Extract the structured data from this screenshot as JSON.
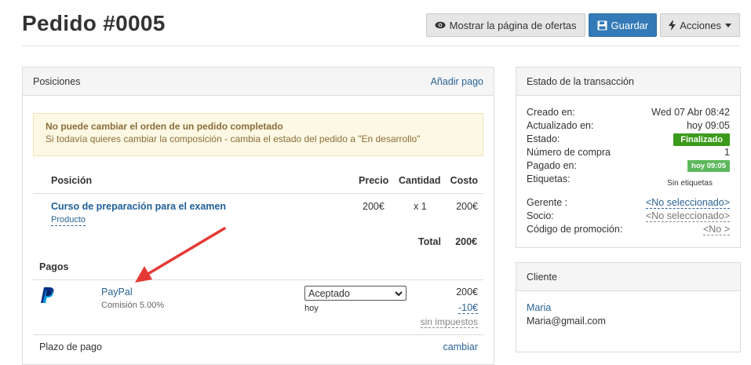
{
  "page": {
    "title": "Pedido #0005"
  },
  "header": {
    "show_offer_label": "Mostrar la página de ofertas",
    "save_label": "Guardar",
    "actions_label": "Acciones"
  },
  "positions_panel": {
    "title": "Posiciones",
    "add_payment_link": "Añadir pago",
    "warning_title": "No puede cambiar el orden de un pedido completado",
    "warning_text": "Si todavía quieres cambiar la composición - cambia el estado del pedido a \"En desarrollo\"",
    "table": {
      "headers": {
        "position": "Posición",
        "price": "Precio",
        "quantity": "Cantidad",
        "cost": "Costo"
      },
      "rows": [
        {
          "name": "Curso de preparación para el examen",
          "type": "Producto",
          "price": "200€",
          "quantity": "x 1",
          "cost": "200€"
        }
      ],
      "total_label": "Total",
      "total_value": "200€"
    },
    "payments": {
      "title": "Pagos",
      "items": [
        {
          "method": "PayPal",
          "commission": "Comisión 5.00%",
          "status": "Aceptado",
          "date": "hoy",
          "amount": "200€",
          "fee": "-10€",
          "tax": "sin impuestos"
        }
      ]
    },
    "term": {
      "label": "Plazo de pago",
      "change_link": "cambiar"
    }
  },
  "transaction_panel": {
    "title": "Estado de la transacción",
    "created_label": "Creado en:",
    "created_value": "Wed 07 Abr 08:42",
    "updated_label": "Actualizado en:",
    "updated_value": "hoy 09:05",
    "status_label": "Estado:",
    "status_value": "Finalizado",
    "purchase_number_label": "Número de compra",
    "purchase_number_value": "1",
    "paid_label": "Pagado en:",
    "paid_value": "hoy 09:05",
    "tags_label": "Etiquetas:",
    "tags_value": "Sin etiquetas",
    "manager_label": "Gerente :",
    "manager_value": "<No seleccionado>",
    "partner_label": "Socio:",
    "partner_value": "<No seleccionado>",
    "promo_label": "Código de promoción:",
    "promo_value": "<No >"
  },
  "client_panel": {
    "title": "Cliente",
    "name": "Maria",
    "email": "Maria@gmail.com"
  },
  "colors": {
    "primary": "#337ab7",
    "link": "#2a6496",
    "status_success": "#3c9a1b",
    "warning_bg": "#fcf8e3",
    "arrow": "#e53935"
  }
}
